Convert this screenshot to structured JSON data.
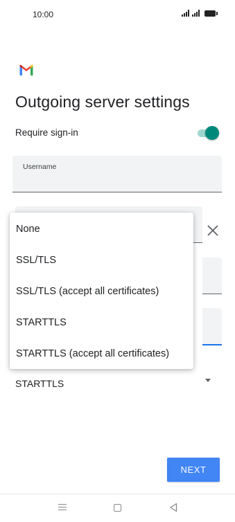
{
  "status_bar": {
    "time": "10:00",
    "signal_icon": "signal-bars-icon",
    "battery_icon": "battery-full-icon"
  },
  "app": {
    "logo_icon": "gmail-icon",
    "logo_colors": [
      "#4285F4",
      "#34A853",
      "#FBBC05",
      "#EA4335",
      "#C5221F"
    ]
  },
  "page": {
    "title": "Outgoing server settings"
  },
  "require_signin": {
    "label": "Require sign-in",
    "enabled": true,
    "accent_color": "#00897B"
  },
  "username_field": {
    "label": "Username",
    "value": ""
  },
  "security_dropdown": {
    "selected": "STARTTLS",
    "options": [
      "None",
      "SSL/TLS",
      "SSL/TLS (accept all certificates)",
      "STARTTLS",
      "STARTTLS (accept all certificates)"
    ]
  },
  "actions": {
    "next_label": "NEXT",
    "button_color": "#4285F4",
    "clear_icon": "close-icon"
  },
  "nav_bar": {
    "menu_icon": "menu-icon",
    "home_icon": "home-square-icon",
    "back_icon": "back-triangle-icon"
  }
}
